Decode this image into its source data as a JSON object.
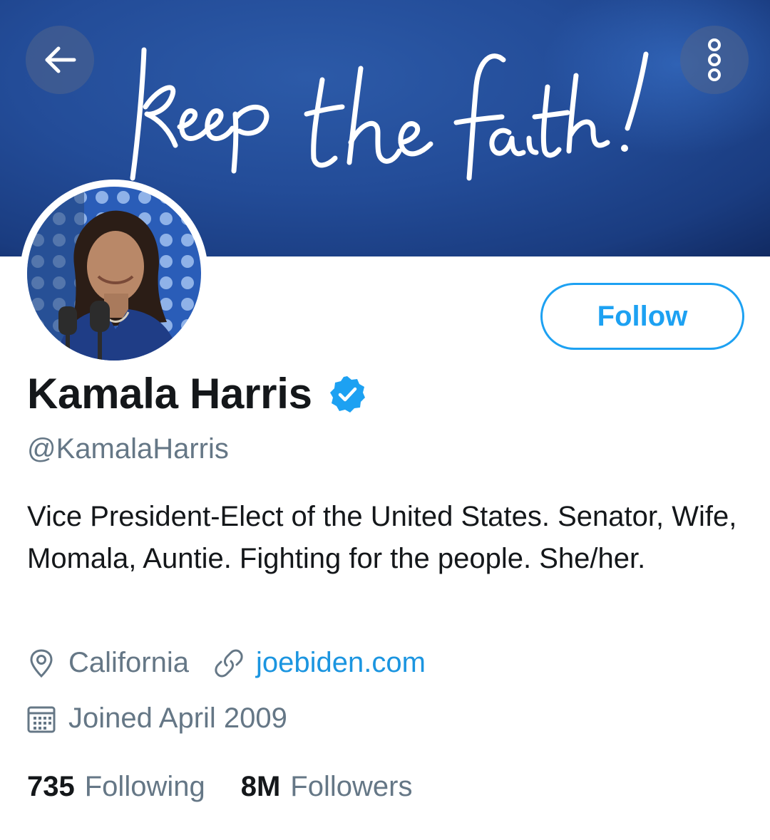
{
  "banner": {
    "handwriting": "keep the faith!",
    "background_color": "#234c98"
  },
  "header": {
    "back_icon": "arrow-left-icon",
    "more_icon": "more-vertical-icon"
  },
  "profile": {
    "display_name": "Kamala Harris",
    "verified": true,
    "verified_icon": "verified-badge-icon",
    "handle": "@KamalaHarris",
    "follow_label": "Follow",
    "bio": "Vice President-Elect of the United States. Senator, Wife, Momala, Auntie. Fighting for the people. She/her.",
    "location": "California",
    "location_icon": "location-pin-icon",
    "website": "joebiden.com",
    "website_icon": "link-icon",
    "joined": "Joined April 2009",
    "joined_icon": "calendar-icon"
  },
  "stats": {
    "following_count": "735",
    "following_label": "Following",
    "followers_count": "8M",
    "followers_label": "Followers"
  },
  "colors": {
    "accent": "#1da1f2",
    "link": "#1b95e0",
    "secondary_text": "#657786",
    "primary_text": "#14171a"
  }
}
